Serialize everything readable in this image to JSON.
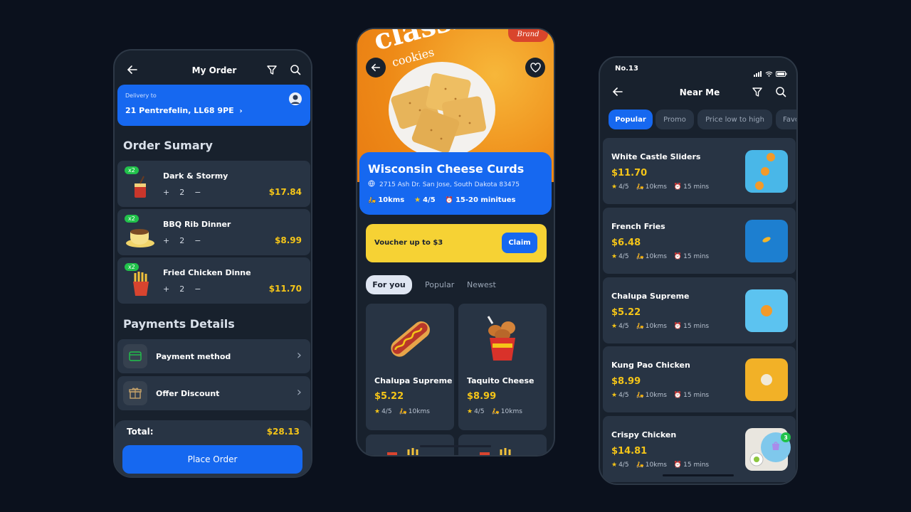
{
  "left": {
    "title": "My Order",
    "delivery_label": "Delivery to",
    "delivery_address": "21 Pentrefelin, LL68 9PE",
    "order_summary_title": "Order Sumary",
    "items": [
      {
        "badge": "x2",
        "name": "Dark & Stormy",
        "minus": "+",
        "qty": "2",
        "plus": "−",
        "price": "$17.84"
      },
      {
        "badge": "x2",
        "name": "BBQ Rib Dinner",
        "minus": "+",
        "qty": "2",
        "plus": "−",
        "price": "$8.99"
      },
      {
        "badge": "x2",
        "name": "Fried Chicken Dinne",
        "minus": "+",
        "qty": "2",
        "plus": "−",
        "price": "$11.70"
      }
    ],
    "payments_title": "Payments Details",
    "payment_method": "Payment method",
    "offer_discount": "Offer Discount",
    "total_label": "Total:",
    "total_value": "$28.13",
    "place_order": "Place Order"
  },
  "middle": {
    "hero_text_1": "classic",
    "hero_text_2": "cookies",
    "brand": "Brand",
    "restaurant_name": "Wisconsin Cheese Curds",
    "address": "2715 Ash Dr. San Jose, South Dakota 83475",
    "distance": "10kms",
    "rating": "4/5",
    "time": "15-20 minitues",
    "voucher_text": "Voucher up to $3",
    "claim_label": "Claim",
    "tabs": [
      "For you",
      "Popular",
      "Newest"
    ],
    "products": [
      {
        "name": "Chalupa Supreme",
        "price": "$5.22",
        "rating": "4/5",
        "distance": "10kms"
      },
      {
        "name": "Taquito Cheese",
        "price": "$8.99",
        "rating": "4/5",
        "distance": "10kms"
      }
    ]
  },
  "right": {
    "status_time": "No.13",
    "title": "Near Me",
    "chips": [
      "Popular",
      "Promo",
      "Price low to high",
      "Favo"
    ],
    "items": [
      {
        "name": "White Castle Sliders",
        "price": "$11.70",
        "rating": "4/5",
        "distance": "10kms",
        "time": "15 mins"
      },
      {
        "name": "French Fries",
        "price": "$6.48",
        "rating": "4/5",
        "distance": "10kms",
        "time": "15 mins"
      },
      {
        "name": "Chalupa Supreme",
        "price": "$5.22",
        "rating": "4/5",
        "distance": "10kms",
        "time": "15 mins"
      },
      {
        "name": "Kung Pao Chicken",
        "price": "$8.99",
        "rating": "4/5",
        "distance": "10kms",
        "time": "15 mins"
      },
      {
        "name": "Crispy Chicken",
        "price": "$14.81",
        "rating": "4/5",
        "distance": "10kms",
        "time": "15 mins"
      }
    ],
    "cart_count": "3"
  },
  "colors": {
    "accent": "#1668f0",
    "price": "#f5c518",
    "bg": "#0b111d",
    "card": "#283444",
    "green": "#21c24b",
    "voucher": "#f6d234"
  },
  "icons": [
    "back-arrow-icon",
    "filter-icon",
    "search-icon",
    "heart-icon",
    "wallet-icon",
    "gift-icon",
    "chevron-right-icon",
    "star-icon",
    "scooter-icon",
    "clock-icon",
    "globe-icon",
    "signal-icon",
    "wifi-icon",
    "battery-icon",
    "bag-icon"
  ]
}
